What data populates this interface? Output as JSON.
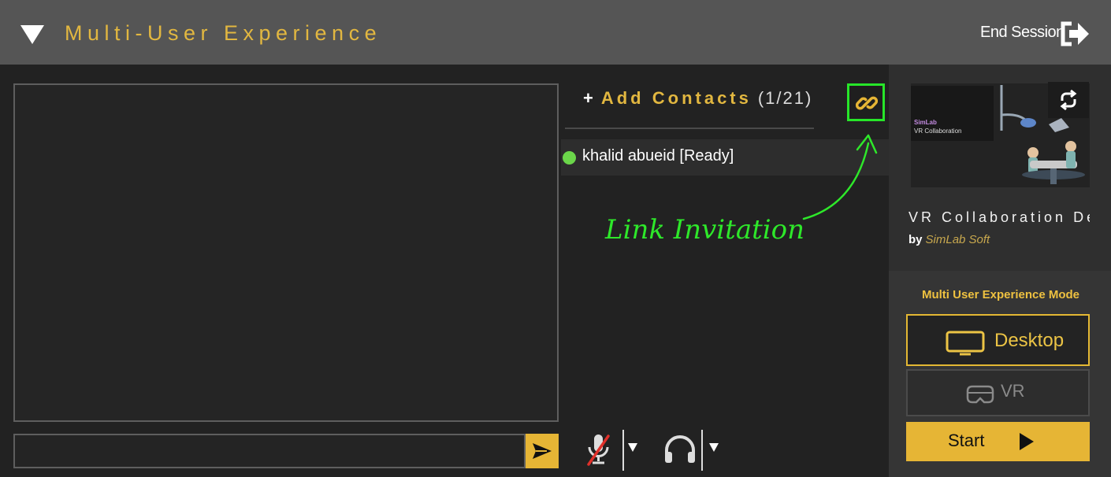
{
  "header": {
    "title": "Multi-User Experience",
    "end_session_label": "End Session"
  },
  "chat": {
    "input_value": "",
    "input_placeholder": ""
  },
  "contacts": {
    "add_plus": "+",
    "add_label": "Add Contacts",
    "count": "(1/21)",
    "items": [
      {
        "name": "khalid abueid [Ready]",
        "status_color": "#6bd64a"
      }
    ]
  },
  "annotation": {
    "text": "Link Invitation",
    "color": "#2ee82a"
  },
  "project": {
    "thumbnail_brand": "SimLab",
    "thumbnail_subtitle": "VR Collaboration",
    "title": "VR Collaboration De",
    "by_label": "by",
    "author": "SimLab Soft"
  },
  "mode": {
    "label": "Multi User Experience Mode",
    "desktop_label": "Desktop",
    "vr_label": "VR",
    "selected": "Desktop",
    "start_label": "Start"
  },
  "icons": {
    "collapse": "triangle-down-icon",
    "end_session": "exit-door-icon",
    "send": "send-arrow-icon",
    "link": "link-icon",
    "sync": "sync-icon",
    "mic": "mic-muted-icon",
    "headset": "headphones-icon",
    "desktop": "monitor-icon",
    "vr": "vr-headset-icon",
    "play": "play-icon"
  },
  "colors": {
    "accent": "#e6b535",
    "header_bg": "#555555",
    "panel_bg": "#222222",
    "highlight": "#27e629"
  }
}
